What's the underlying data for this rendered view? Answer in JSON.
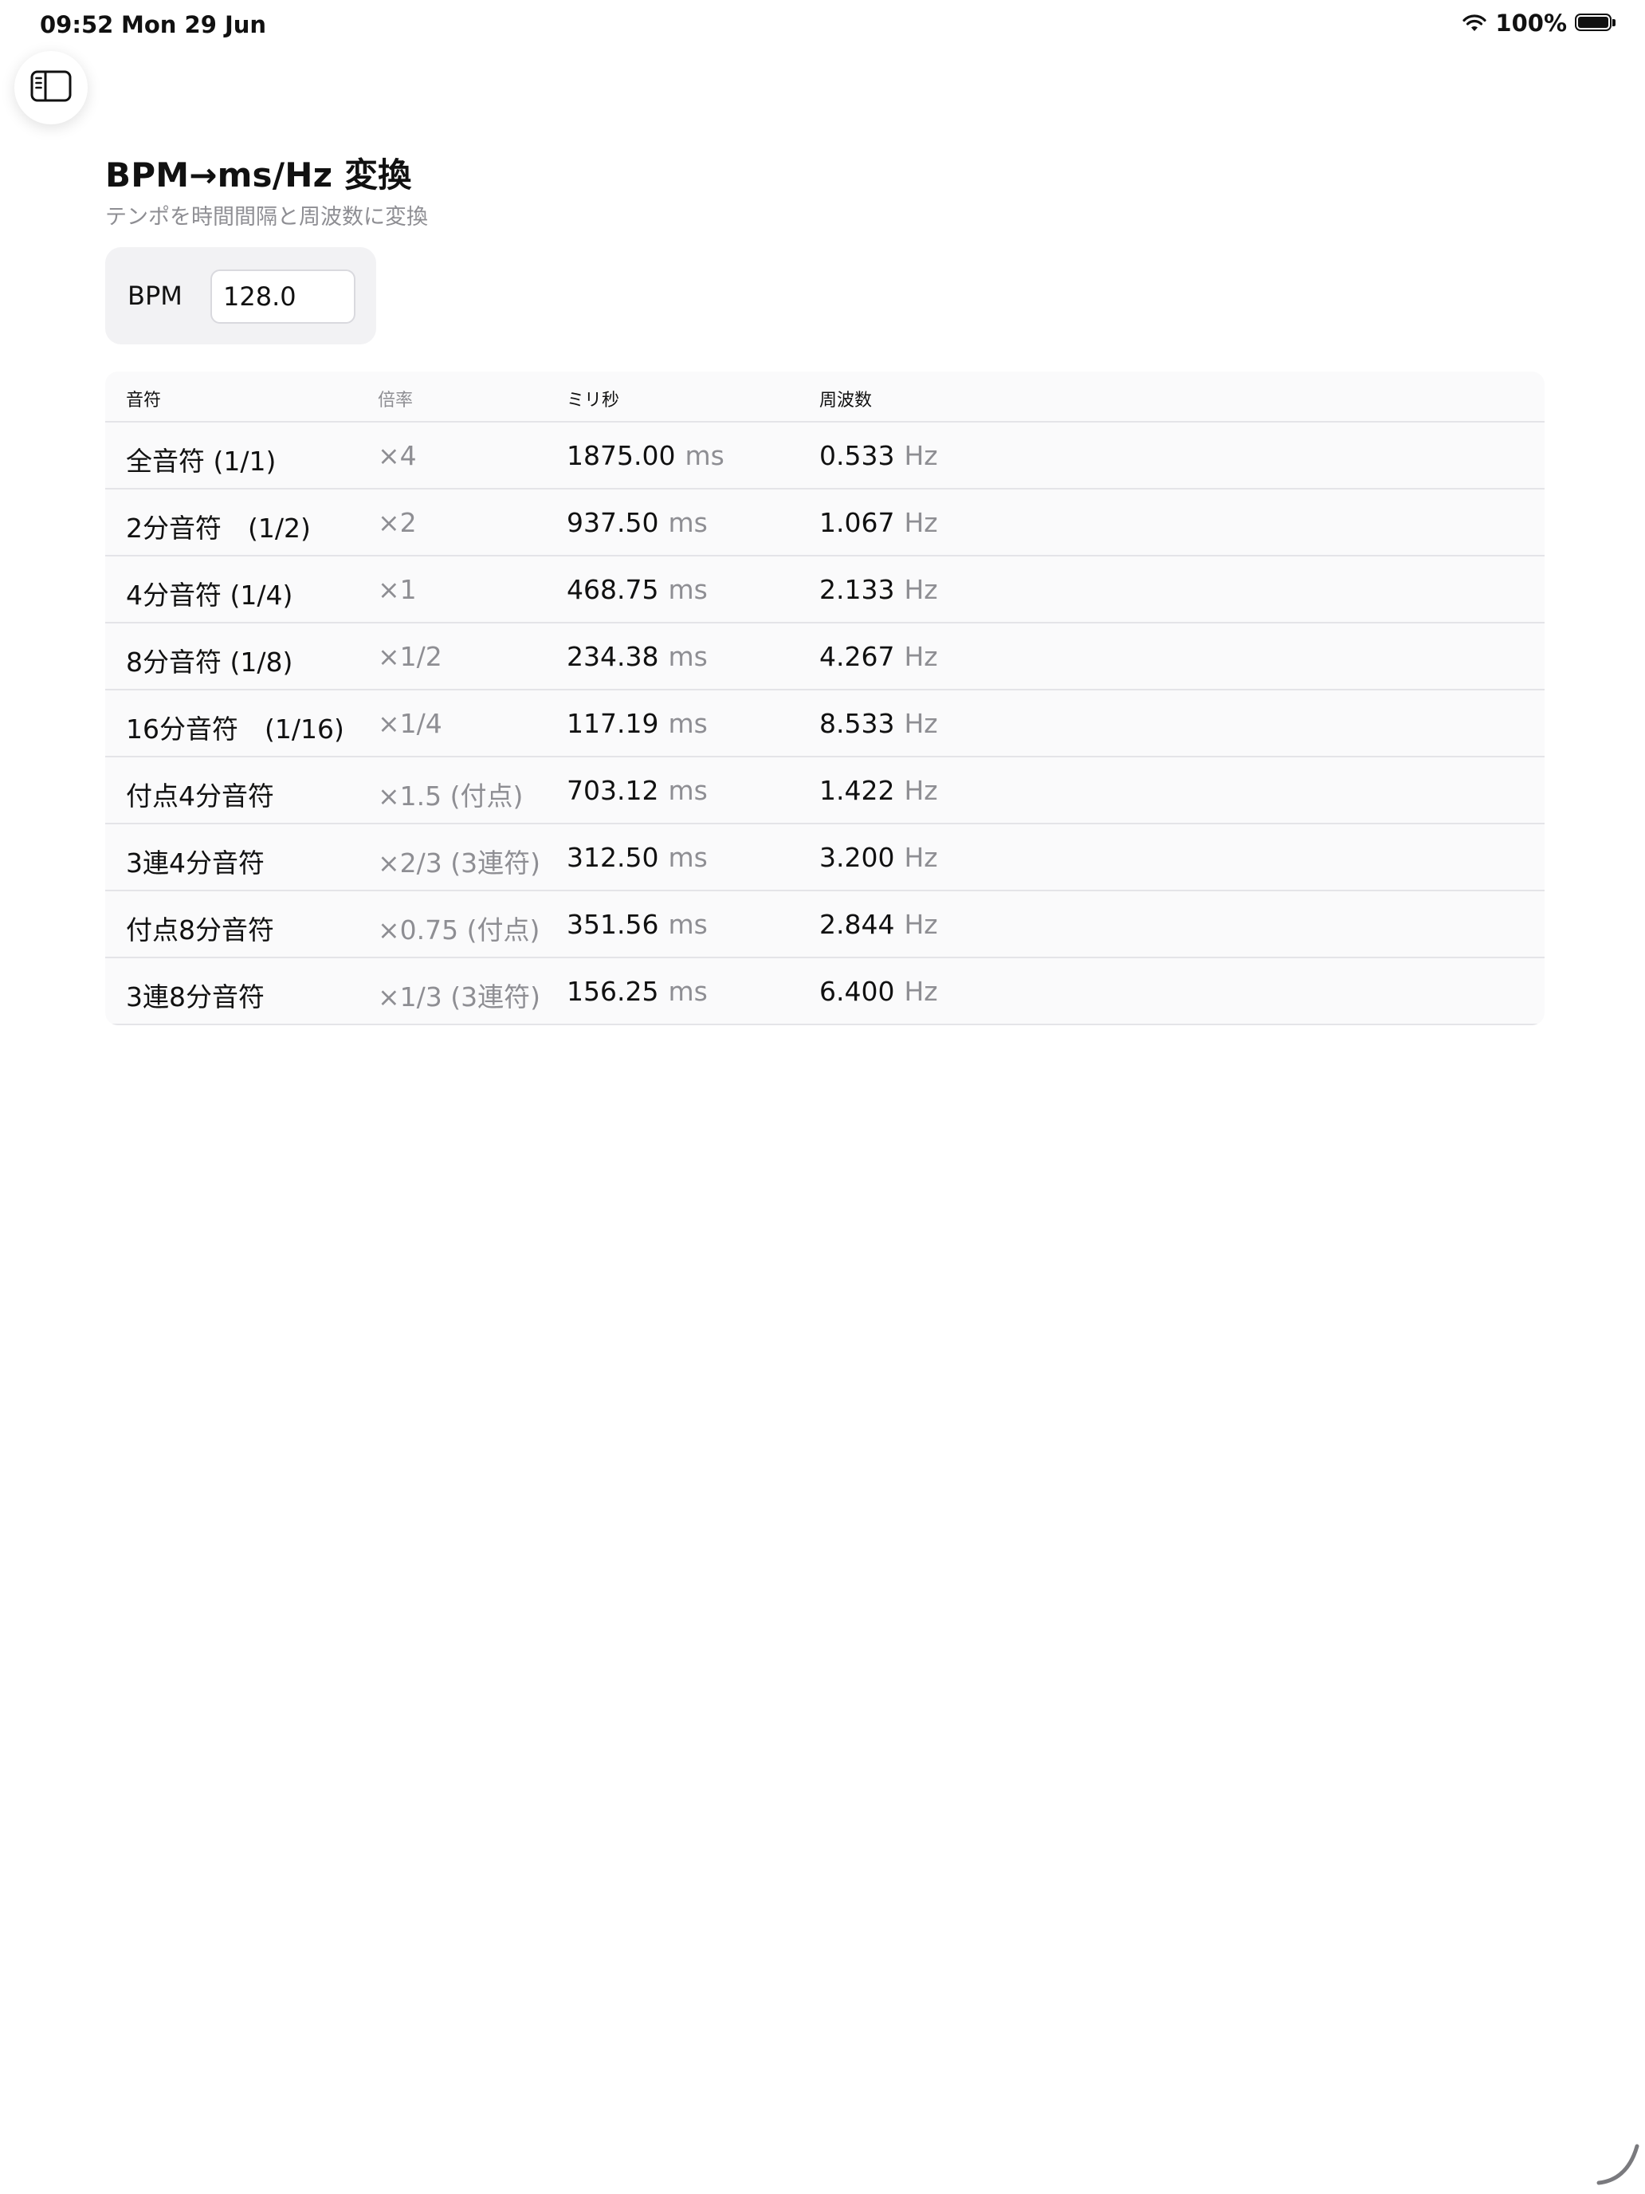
{
  "status_bar": {
    "time": "09:52",
    "date": "Mon 29 Jun",
    "battery": "100%",
    "icons": [
      "wifi-icon",
      "battery-icon"
    ]
  },
  "sidebar_toggle": {
    "icon": "sidebar-toggle-icon"
  },
  "header": {
    "title": "BPM→ms/Hz 変換",
    "subtitle": "テンポを時間間隔と周波数に変換"
  },
  "bpm": {
    "label": "BPM",
    "value": "128.0"
  },
  "table": {
    "columns": [
      "音符",
      "倍率",
      "ミリ秒",
      "周波数"
    ],
    "rows": [
      {
        "note": "全音符 (1/1)",
        "mult": "×4",
        "ms": "1875.00",
        "ms_unit": "ms",
        "hz": "0.533",
        "hz_unit": "Hz"
      },
      {
        "note": "2分音符　(1/2)",
        "mult": "×2",
        "ms": "937.50",
        "ms_unit": "ms",
        "hz": "1.067",
        "hz_unit": "Hz"
      },
      {
        "note": "4分音符 (1/4)",
        "mult": "×1",
        "ms": "468.75",
        "ms_unit": "ms",
        "hz": "2.133",
        "hz_unit": "Hz"
      },
      {
        "note": "8分音符 (1/8)",
        "mult": "×1/2",
        "ms": "234.38",
        "ms_unit": "ms",
        "hz": "4.267",
        "hz_unit": "Hz"
      },
      {
        "note": "16分音符　(1/16)",
        "mult": "×1/4",
        "ms": "117.19",
        "ms_unit": "ms",
        "hz": "8.533",
        "hz_unit": "Hz"
      },
      {
        "note": "付点4分音符",
        "mult": "×1.5 (付点)",
        "ms": "703.12",
        "ms_unit": "ms",
        "hz": "1.422",
        "hz_unit": "Hz"
      },
      {
        "note": "3連4分音符",
        "mult": "×2/3 (3連符)",
        "ms": "312.50",
        "ms_unit": "ms",
        "hz": "3.200",
        "hz_unit": "Hz"
      },
      {
        "note": "付点8分音符",
        "mult": "×0.75 (付点)",
        "ms": "351.56",
        "ms_unit": "ms",
        "hz": "2.844",
        "hz_unit": "Hz"
      },
      {
        "note": "3連8分音符",
        "mult": "×1/3 (3連符)",
        "ms": "156.25",
        "ms_unit": "ms",
        "hz": "6.400",
        "hz_unit": "Hz"
      }
    ]
  }
}
